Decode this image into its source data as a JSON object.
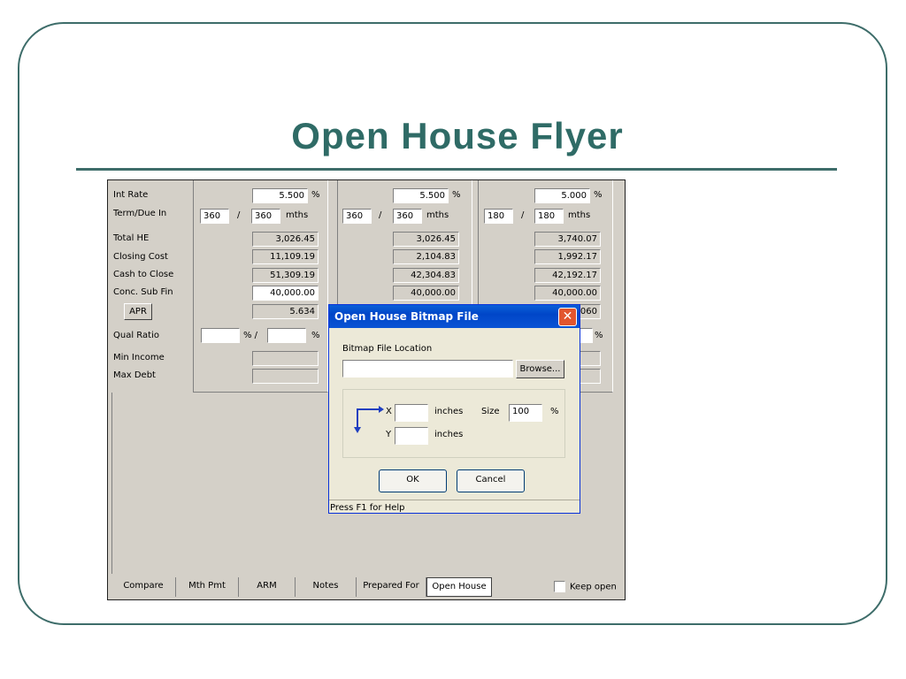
{
  "slide": {
    "title": "Open House Flyer"
  },
  "app": {
    "rows": [
      "Int Rate",
      "Term/Due In",
      "Total HE",
      "Closing Cost",
      "Cash to Close",
      "Conc. Sub Fin"
    ],
    "apr_button": "APR",
    "qual_label": "Qual Ratio",
    "min_income_label": "Min Income",
    "max_debt_label": "Max Debt",
    "pct": "%",
    "slash": "/",
    "pct_slash": "% /",
    "mths": "mths",
    "columns": [
      {
        "int_rate": "5.500",
        "term": "360",
        "due": "360",
        "total_he": "3,026.45",
        "closing": "11,109.19",
        "cash": "51,309.19",
        "conc": "40,000.00",
        "apr": "5.634"
      },
      {
        "int_rate": "5.500",
        "term": "360",
        "due": "360",
        "total_he": "3,026.45",
        "closing": "2,104.83",
        "cash": "42,304.83",
        "conc": "40,000.00"
      },
      {
        "int_rate": "5.000",
        "term": "180",
        "due": "180",
        "total_he": "3,740.07",
        "closing": "1,992.17",
        "cash": "42,192.17",
        "conc": "40,000.00",
        "apr_partial": ".060"
      }
    ]
  },
  "tabs": [
    "Compare",
    "Mth Pmt",
    "ARM",
    "Notes",
    "Prepared For",
    "Open House"
  ],
  "keep_open": "Keep open",
  "dialog": {
    "title": "Open House Bitmap File",
    "close": "✕",
    "location_label": "Bitmap File Location",
    "location_value": "",
    "browse": "Browse...",
    "x_label": "X",
    "y_label": "Y",
    "x_value": "",
    "y_value": "",
    "inches": "inches",
    "size_label": "Size",
    "size_value": "100",
    "pct": "%",
    "ok": "OK",
    "cancel": "Cancel",
    "status": "Press F1 for Help"
  }
}
